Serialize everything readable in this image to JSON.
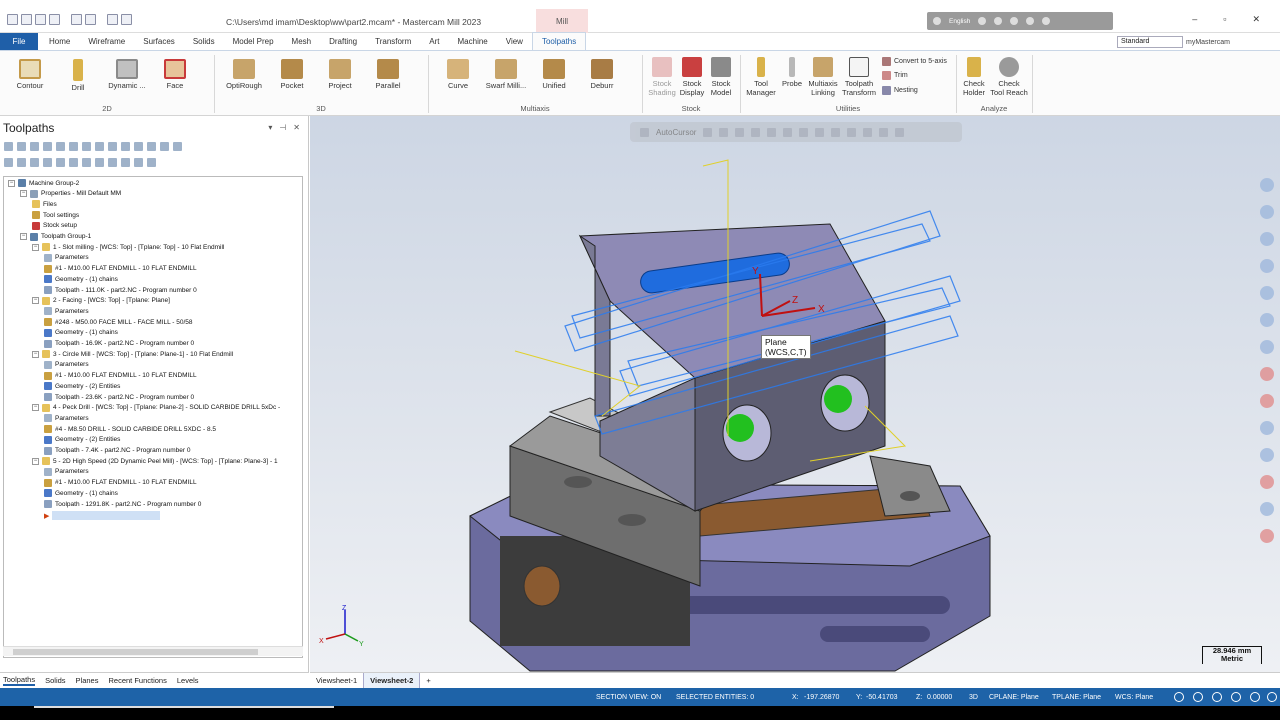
{
  "title_bar": {
    "title": "C:\\Users\\md imam\\Desktop\\ww\\part2.mcam* - Mastercam Mill 2023",
    "context_tab": "Mill",
    "language": "English"
  },
  "menu": {
    "tabs": [
      "File",
      "Home",
      "Wireframe",
      "Surfaces",
      "Solids",
      "Model Prep",
      "Mesh",
      "Drafting",
      "Transform",
      "Art",
      "Machine",
      "View",
      "Toolpaths"
    ],
    "active_tab": "Toolpaths",
    "workspace_select": "Standard",
    "my_mastercam": "myMastercam"
  },
  "ribbon": {
    "group_2d": {
      "label": "2D",
      "buttons": [
        "Contour",
        "Drill",
        "Dynamic ...",
        "Face"
      ]
    },
    "group_3d": {
      "label": "3D",
      "buttons": [
        "OptiRough",
        "Pocket",
        "Project",
        "Parallel"
      ]
    },
    "group_multiaxis": {
      "label": "Multiaxis",
      "buttons": [
        "Curve",
        "Swarf Milli...",
        "Unified",
        "Deburr"
      ]
    },
    "group_stock": {
      "label": "Stock",
      "buttons": [
        "Stock\nShading",
        "Stock\nDisplay",
        "Stock\nModel"
      ]
    },
    "group_utilities": {
      "label": "Utilities",
      "buttons": [
        "Tool\nManager",
        "Probe",
        "Multiaxis\nLinking",
        "Toolpath\nTransform"
      ],
      "small": [
        "Convert to 5-axis",
        "Trim",
        "Nesting"
      ]
    },
    "group_analyze": {
      "label": "Analyze",
      "buttons": [
        "Check\nHolder",
        "Check\nTool Reach"
      ]
    }
  },
  "panel": {
    "title": "Toolpaths",
    "tree": [
      {
        "level": 0,
        "icon": "machine",
        "text": "Machine Group-2"
      },
      {
        "level": 1,
        "icon": "properties",
        "text": "Properties - Mill Default MM"
      },
      {
        "level": 2,
        "icon": "folder",
        "text": "Files"
      },
      {
        "level": 2,
        "icon": "tool",
        "text": "Tool settings"
      },
      {
        "level": 2,
        "icon": "stock",
        "text": "Stock setup"
      },
      {
        "level": 1,
        "icon": "group",
        "text": "Toolpath Group-1"
      },
      {
        "level": 2,
        "icon": "op",
        "text": "1 - Slot milling - [WCS: Top] - [Tplane: Top] - 10 Flat Endmill"
      },
      {
        "level": 3,
        "icon": "params",
        "text": "Parameters"
      },
      {
        "level": 3,
        "icon": "tool",
        "text": "#1 - M10.00 FLAT ENDMILL - 10 FLAT ENDMILL"
      },
      {
        "level": 3,
        "icon": "geom",
        "text": "Geometry - (1) chains"
      },
      {
        "level": 3,
        "icon": "path",
        "text": "Toolpath - 111.0K - part2.NC - Program number 0"
      },
      {
        "level": 2,
        "icon": "op",
        "text": "2 - Facing - [WCS: Top] - [Tplane: Plane]"
      },
      {
        "level": 3,
        "icon": "params",
        "text": "Parameters"
      },
      {
        "level": 3,
        "icon": "tool",
        "text": "#248 - M50.00 FACE MILL - FACE MILL - 50/58"
      },
      {
        "level": 3,
        "icon": "geom",
        "text": "Geometry - (1) chains"
      },
      {
        "level": 3,
        "icon": "path",
        "text": "Toolpath - 16.9K - part2.NC - Program number 0"
      },
      {
        "level": 2,
        "icon": "op",
        "text": "3 - Circle Mill - [WCS: Top] - [Tplane: Plane-1] - 10 Flat Endmill"
      },
      {
        "level": 3,
        "icon": "params",
        "text": "Parameters"
      },
      {
        "level": 3,
        "icon": "tool",
        "text": "#1 - M10.00 FLAT ENDMILL - 10 FLAT ENDMILL"
      },
      {
        "level": 3,
        "icon": "geom",
        "text": "Geometry - (2) Entities"
      },
      {
        "level": 3,
        "icon": "path",
        "text": "Toolpath - 23.6K - part2.NC - Program number 0"
      },
      {
        "level": 2,
        "icon": "op",
        "text": "4 - Peck Drill - [WCS: Top] - [Tplane: Plane-2] - SOLID CARBIDE DRILL 5xDc -"
      },
      {
        "level": 3,
        "icon": "params",
        "text": "Parameters"
      },
      {
        "level": 3,
        "icon": "tool",
        "text": "#4 - M8.50 DRILL - SOLID CARBIDE DRILL 5XDC - 8.5"
      },
      {
        "level": 3,
        "icon": "geom",
        "text": "Geometry - (2) Entities"
      },
      {
        "level": 3,
        "icon": "path",
        "text": "Toolpath - 7.4K - part2.NC - Program number 0"
      },
      {
        "level": 2,
        "icon": "op",
        "text": "5 - 2D High Speed (2D Dynamic Peel Mill) - [WCS: Top] - [Tplane: Plane-3] - 1"
      },
      {
        "level": 3,
        "icon": "params",
        "text": "Parameters"
      },
      {
        "level": 3,
        "icon": "tool",
        "text": "#1 - M10.00 FLAT ENDMILL - 10 FLAT ENDMILL"
      },
      {
        "level": 3,
        "icon": "geom",
        "text": "Geometry - (1) chains"
      },
      {
        "level": 3,
        "icon": "path",
        "text": "Toolpath - 1291.8K - part2.NC - Program number 0"
      }
    ],
    "bottom_tabs": [
      "Toolpaths",
      "Solids",
      "Planes",
      "Recent Functions",
      "Levels"
    ],
    "active_bottom_tab": "Toolpaths"
  },
  "viewport": {
    "autocursor": "AutoCursor",
    "tooltip_line1": "Plane",
    "tooltip_line2": "(WCS,C,T)",
    "scale_value": "28.946 mm",
    "scale_unit": "Metric",
    "axis_x": "X",
    "axis_y": "Y",
    "axis_z": "Z"
  },
  "sheets": {
    "tabs": [
      "Viewsheet-1",
      "Viewsheet-2"
    ],
    "active": "Viewsheet-2",
    "add": "+"
  },
  "status": {
    "section_view": "SECTION VIEW: ON",
    "selected": "SELECTED ENTITIES: 0",
    "x_label": "X:",
    "x_value": "-197.26870",
    "y_label": "Y:",
    "y_value": "-50.41703",
    "z_label": "Z:",
    "z_value": "0.00000",
    "mode": "3D",
    "cplane": "CPLANE: Plane",
    "tplane": "TPLANE: Plane",
    "wcs": "WCS: Plane"
  },
  "colors": {
    "accent": "#1f5fa8",
    "toolpath": "#2a7bef",
    "vise_blue": "#6f6fa8",
    "part_purple": "#8c87b4",
    "green": "#22c01f"
  }
}
